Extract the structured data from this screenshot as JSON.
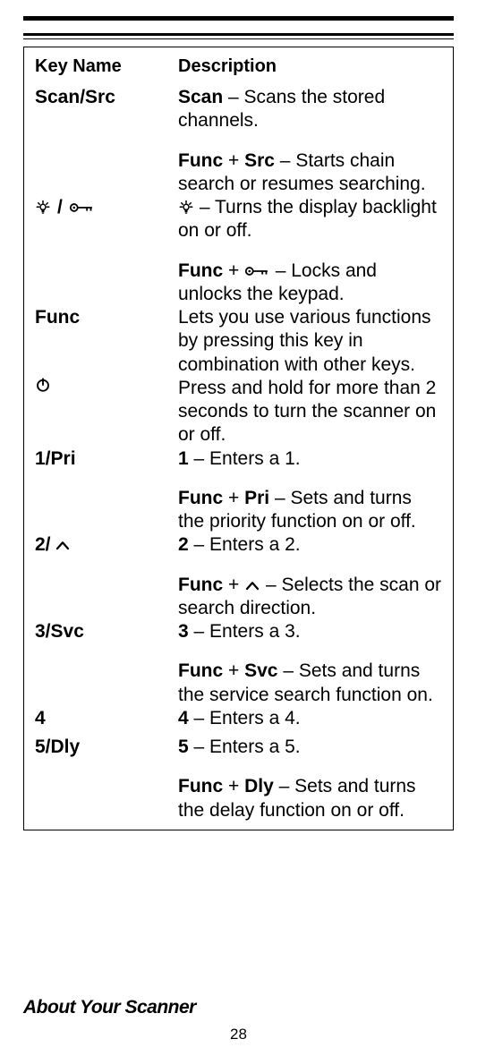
{
  "headers": {
    "key": "Key Name",
    "desc": "Description"
  },
  "rows": [
    {
      "key": {
        "text": "Scan/Src"
      },
      "descs": [
        {
          "parts": [
            {
              "b": "Scan"
            },
            {
              "t": " – Scans the stored channels."
            }
          ]
        },
        {
          "parts": [
            {
              "b": "Func"
            },
            {
              "t": " + "
            },
            {
              "b": "Src"
            },
            {
              "t": " – Starts chain search or resumes searching."
            }
          ]
        }
      ]
    },
    {
      "key": {
        "icons": [
          "light",
          "slash",
          "key"
        ]
      },
      "descs": [
        {
          "parts": [
            {
              "icon": "light"
            },
            {
              "t": " – Turns the display backlight on or off."
            }
          ]
        },
        {
          "parts": [
            {
              "b": "Func"
            },
            {
              "t": " + "
            },
            {
              "icon": "key"
            },
            {
              "t": " – Locks and unlocks the keypad."
            }
          ]
        }
      ]
    },
    {
      "key": {
        "text": "Func"
      },
      "descs": [
        {
          "parts": [
            {
              "t": "Lets you use various functions by pressing this key in combination with other keys."
            }
          ]
        }
      ]
    },
    {
      "key": {
        "icons": [
          "power"
        ]
      },
      "descs": [
        {
          "parts": [
            {
              "t": "Press and hold for more than 2 seconds to turn the scanner on or off."
            }
          ]
        }
      ]
    },
    {
      "key": {
        "text": "1/Pri"
      },
      "descs": [
        {
          "parts": [
            {
              "b": "1"
            },
            {
              "t": " – Enters a 1."
            }
          ]
        },
        {
          "parts": [
            {
              "b": "Func"
            },
            {
              "t": " + "
            },
            {
              "b": "Pri"
            },
            {
              "t": " – Sets and turns the priority function on or off."
            }
          ]
        }
      ]
    },
    {
      "key": {
        "parts": [
          {
            "b": "2/"
          },
          {
            "icon": "up"
          }
        ]
      },
      "descs": [
        {
          "parts": [
            {
              "b": "2"
            },
            {
              "t": " – Enters a 2."
            }
          ]
        },
        {
          "parts": [
            {
              "b": "Func"
            },
            {
              "t": " + "
            },
            {
              "icon": "up"
            },
            {
              "t": " – Selects the scan or search direction."
            }
          ]
        }
      ]
    },
    {
      "key": {
        "text": "3/Svc"
      },
      "descs": [
        {
          "parts": [
            {
              "b": "3"
            },
            {
              "t": " – Enters a 3."
            }
          ]
        },
        {
          "parts": [
            {
              "b": "Func"
            },
            {
              "t": " + "
            },
            {
              "b": "Svc"
            },
            {
              "t": " – Sets and turns the service search function on."
            }
          ]
        }
      ]
    },
    {
      "key": {
        "text": "4"
      },
      "descs": [
        {
          "parts": [
            {
              "b": "4"
            },
            {
              "t": " – Enters a 4."
            }
          ]
        }
      ]
    },
    {
      "key": {
        "text": "5/Dly"
      },
      "descs": [
        {
          "parts": [
            {
              "b": "5"
            },
            {
              "t": " – Enters a 5."
            }
          ]
        },
        {
          "parts": [
            {
              "b": "Func"
            },
            {
              "t": " + "
            },
            {
              "b": "Dly"
            },
            {
              "t": " – Sets and turns the delay function on or off."
            }
          ]
        }
      ]
    }
  ],
  "footer_title": "About Your Scanner",
  "page_number": "28"
}
